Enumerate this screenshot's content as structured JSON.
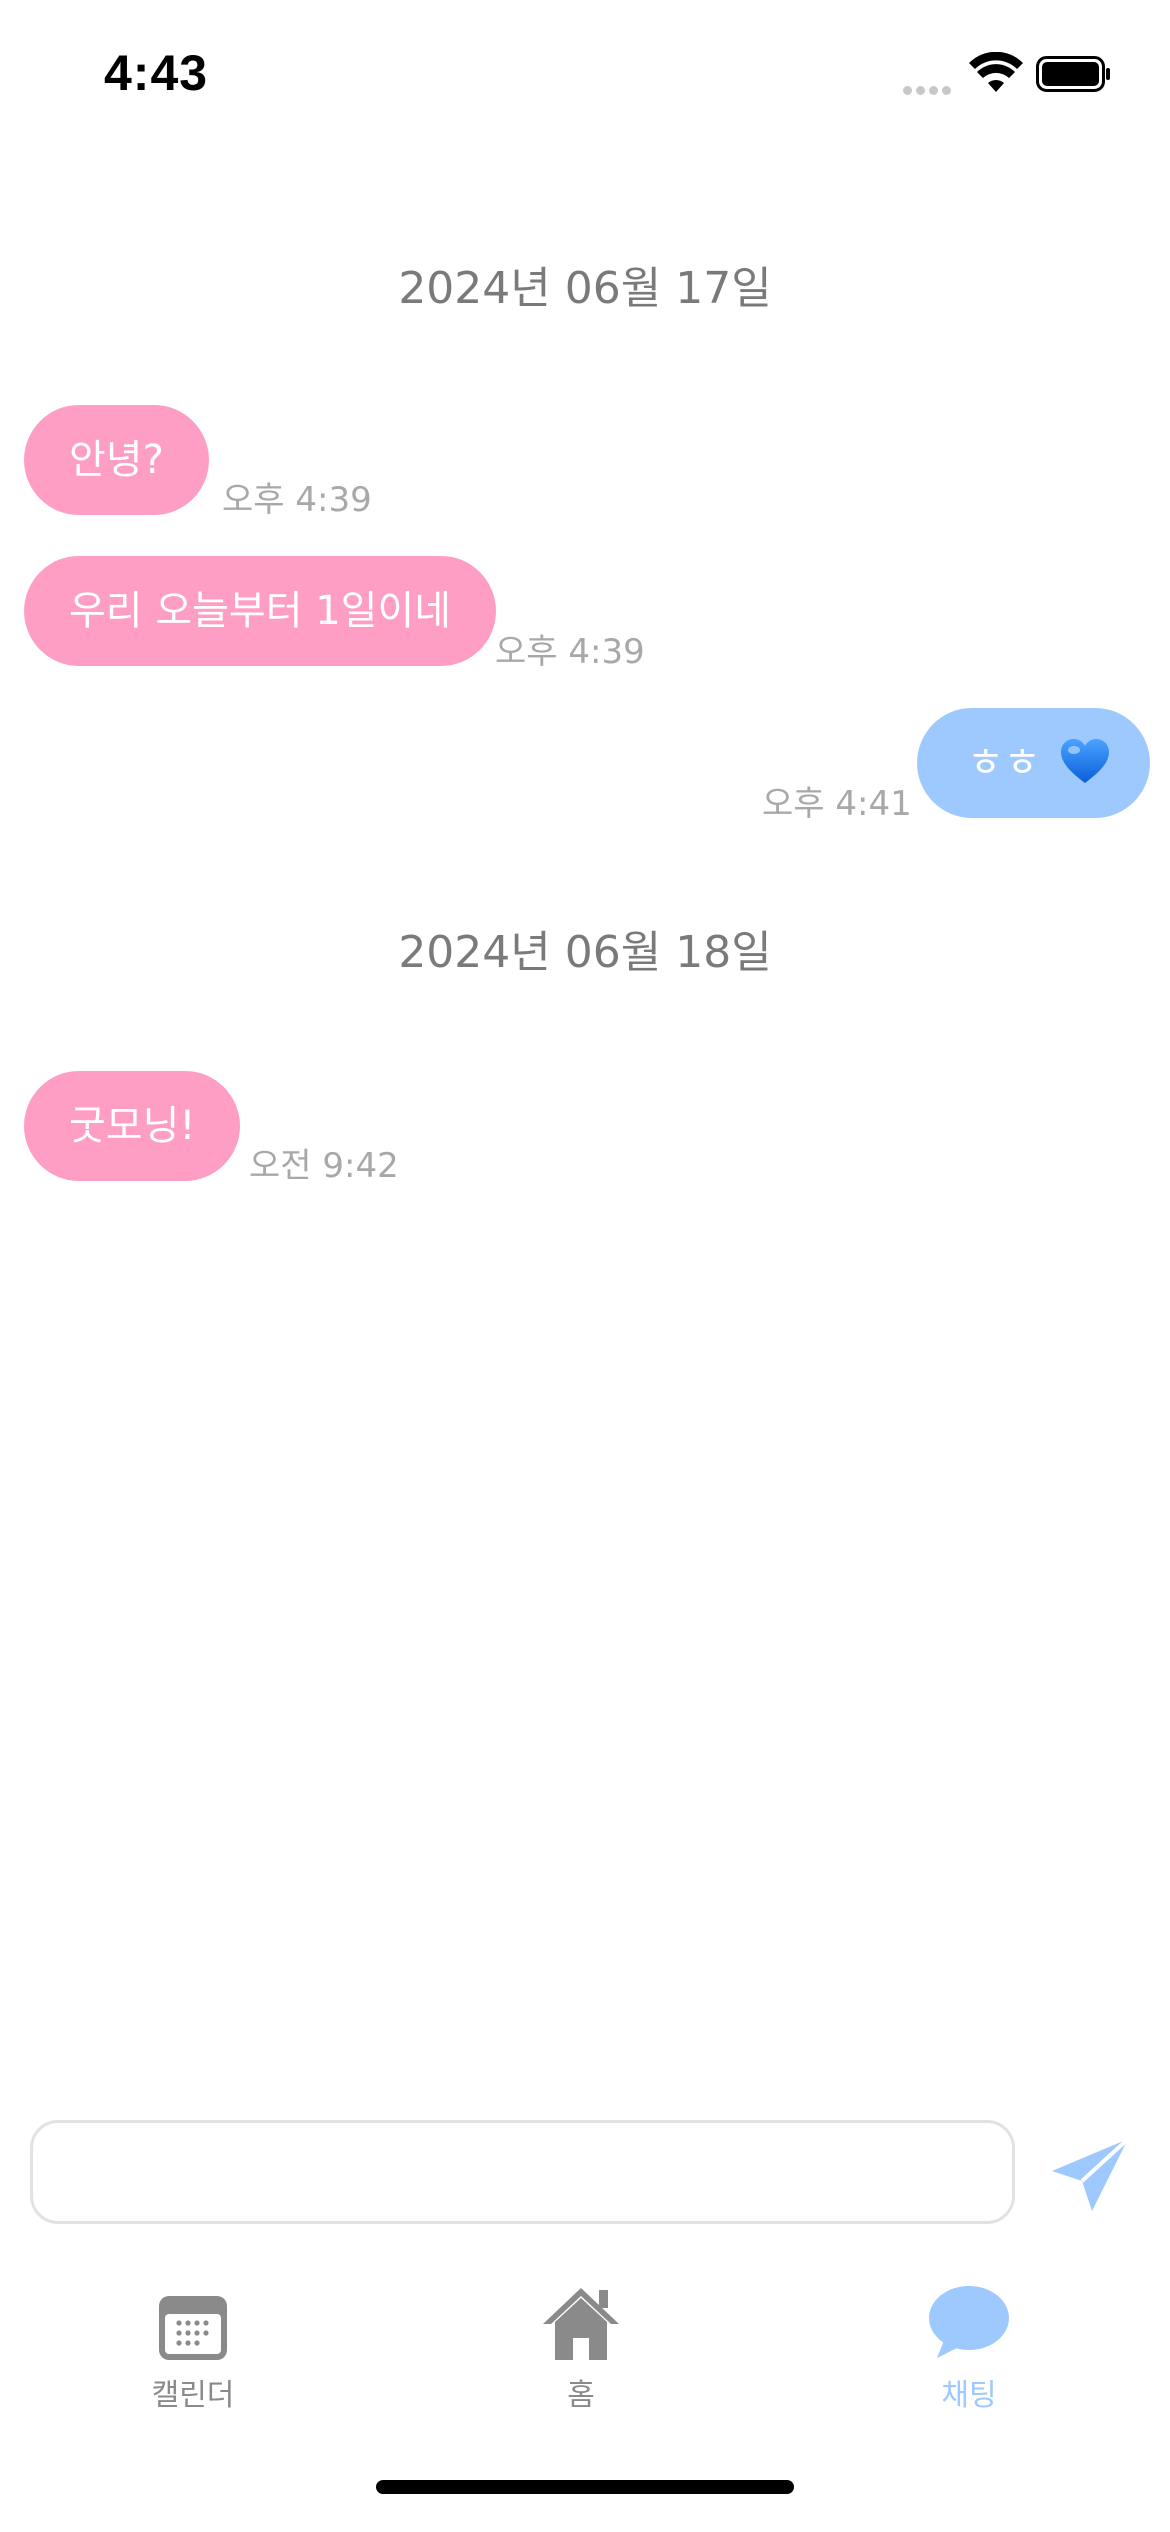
{
  "status_bar": {
    "time": "4:43"
  },
  "chat": {
    "groups": [
      {
        "date": "2024년 06월 17일",
        "messages": [
          {
            "direction": "received",
            "text": "안녕?",
            "time": "오후 4:39"
          },
          {
            "direction": "received",
            "text": "우리 오늘부터 1일이네",
            "time": "오후 4:39"
          },
          {
            "direction": "sent",
            "text": "ㅎㅎ",
            "emoji": "blue-heart",
            "time": "오후 4:41"
          }
        ]
      },
      {
        "date": "2024년 06월 18일",
        "messages": [
          {
            "direction": "received",
            "text": "굿모닝!",
            "time": "오전 9:42"
          }
        ]
      }
    ]
  },
  "composer": {
    "value": "",
    "placeholder": "",
    "send_icon": "paper-plane-icon"
  },
  "tabs": [
    {
      "label": "캘린더",
      "icon": "calendar-icon",
      "active": false
    },
    {
      "label": "홈",
      "icon": "home-icon",
      "active": false
    },
    {
      "label": "채팅",
      "icon": "chat-bubble-icon",
      "active": true
    }
  ],
  "colors": {
    "received_bubble": "#ff9ec4",
    "sent_bubble": "#9ec9ff",
    "accent": "#9ec9ff",
    "inactive_tab": "#8a8a8a",
    "date_text": "#7a7a7a",
    "time_text": "#a8a8a8"
  }
}
